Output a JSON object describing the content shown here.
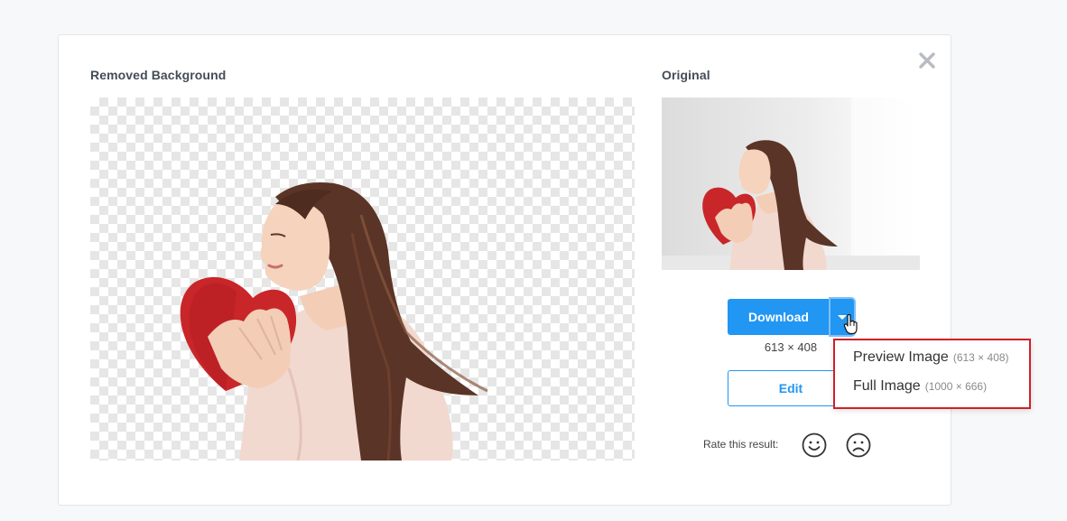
{
  "left_panel": {
    "title": "Removed Background"
  },
  "right_panel": {
    "title": "Original"
  },
  "download": {
    "label": "Download",
    "size_label": "613 × 408"
  },
  "edit": {
    "label": "Edit"
  },
  "dropdown": {
    "items": [
      {
        "label": "Preview Image",
        "size": "(613 × 408)"
      },
      {
        "label": "Full Image",
        "size": "(1000 × 666)"
      }
    ]
  },
  "rating": {
    "label": "Rate this result:"
  },
  "icons": {
    "close": "close-icon",
    "dropdown_toggle": "caret-down-icon",
    "smile": "smile-face-icon",
    "frown": "frown-face-icon",
    "cursor": "hand-pointer-icon"
  },
  "colors": {
    "accent": "#2196f3",
    "highlight_border": "#d21f26",
    "heading_text": "#454c57"
  }
}
